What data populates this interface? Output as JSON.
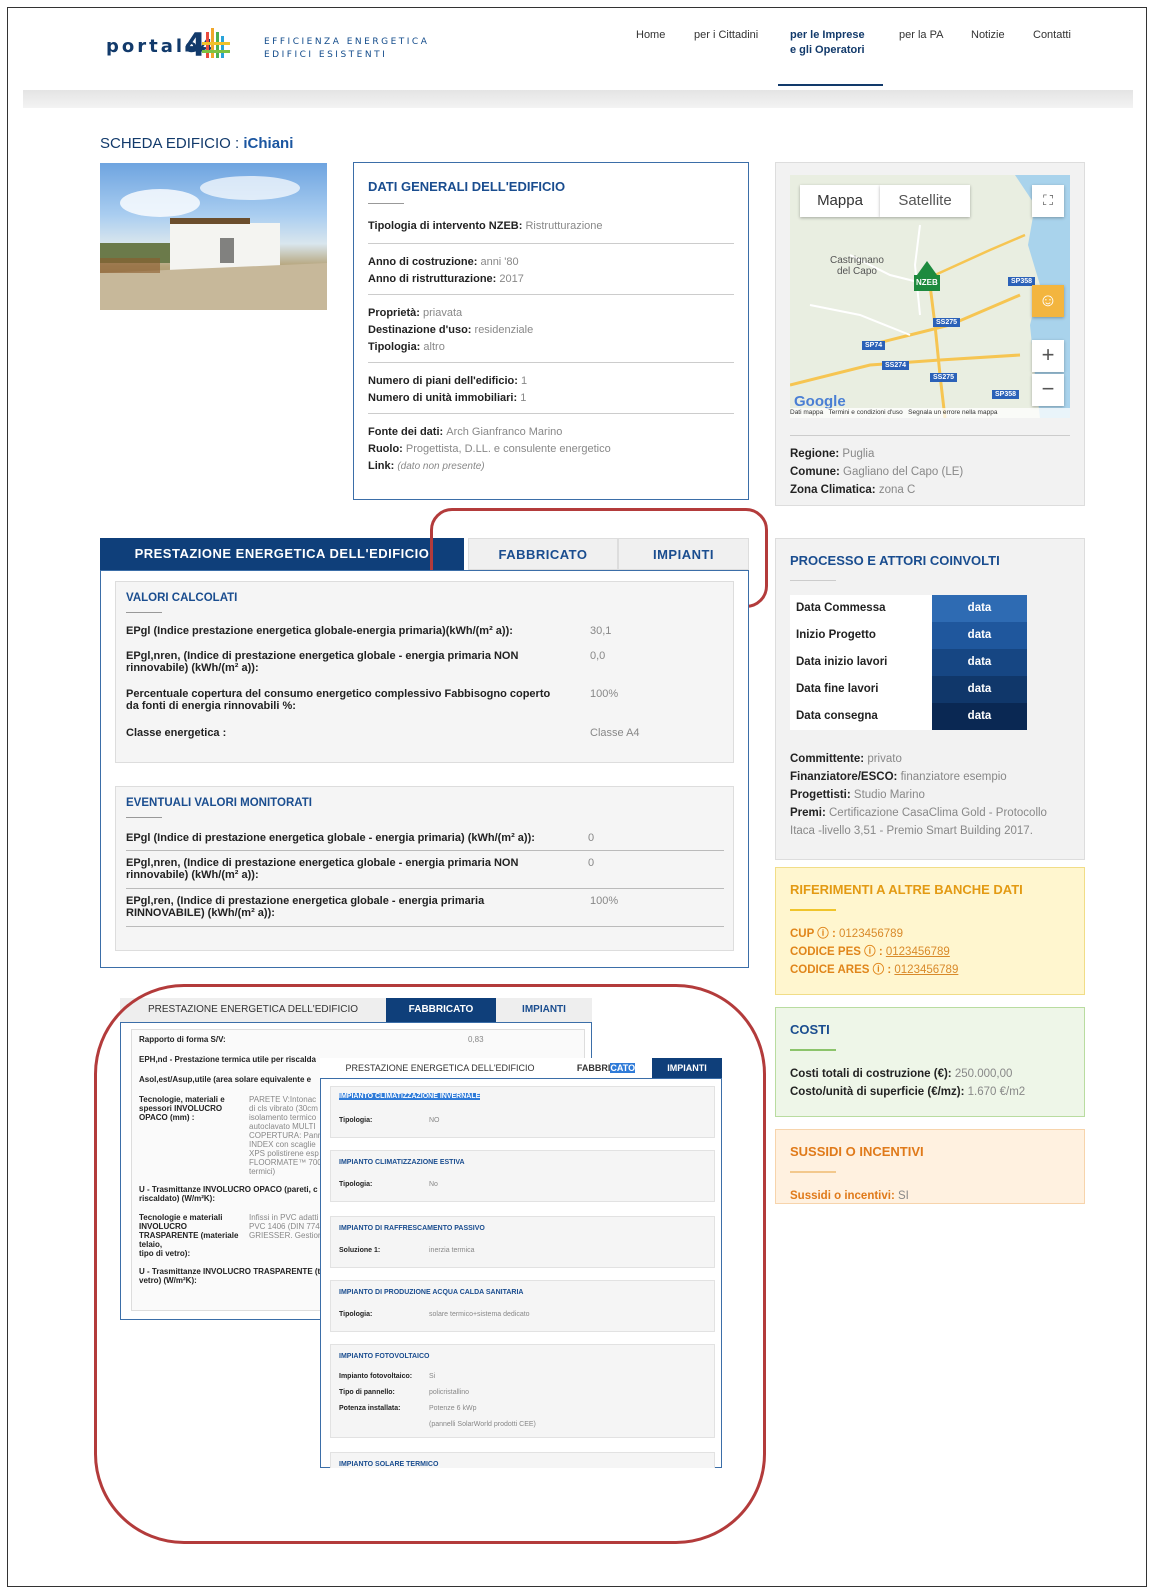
{
  "header": {
    "logo_text": "portale4",
    "tagline_1": "EFFICIENZA ENERGETICA",
    "tagline_2": "EDIFICI ESISTENTI",
    "nav": [
      "Home",
      "per i Cittadini",
      "per le Imprese",
      "e gli Operatori",
      "per la PA",
      "Notizie",
      "Contatti"
    ]
  },
  "page_title": {
    "label": "SCHEDA EDIFICIO :",
    "name": "iChiani"
  },
  "general": {
    "title": "DATI GENERALI DELL'EDIFICIO",
    "rows": [
      {
        "k": "Tipologia di intervento NZEB:",
        "v": "Ristrutturazione"
      },
      {
        "k": "Anno di costruzione:",
        "v": "anni '80"
      },
      {
        "k": "Anno di ristrutturazione:",
        "v": "2017"
      },
      {
        "k": "Proprietà:",
        "v": "priavata"
      },
      {
        "k": "Destinazione d'uso:",
        "v": "residenziale"
      },
      {
        "k": "Tipologia:",
        "v": "altro"
      },
      {
        "k": "Numero di piani dell'edificio:",
        "v": "1"
      },
      {
        "k": "Numero di unità immobiliari:",
        "v": "1"
      },
      {
        "k": "Fonte dei dati:",
        "v": "Arch Gianfranco Marino"
      },
      {
        "k": "Ruolo:",
        "v": "Progettista, D.LL. e consulente energetico"
      },
      {
        "k": "Link:",
        "v": "(dato non presente)"
      }
    ]
  },
  "map": {
    "type_map": "Mappa",
    "type_sat": "Satellite",
    "places": [
      "Castrignano",
      "del Capo",
      "NZEB"
    ],
    "roads": [
      "SP358",
      "SS275",
      "SP74",
      "SS274",
      "SS275",
      "SP358"
    ],
    "zoom_in": "+",
    "zoom_out": "−",
    "attrib": "Dati mappa   Termini e condizioni d'uso   Segnala un errore nella mappa",
    "google": "Google"
  },
  "location": [
    {
      "k": "Regione:",
      "v": "Puglia"
    },
    {
      "k": "Comune:",
      "v": "Gagliano del Capo (LE)"
    },
    {
      "k": "Zona Climatica:",
      "v": "zona C"
    }
  ],
  "tabs": [
    "PRESTAZIONE ENERGETICA DELL'EDIFICIO",
    "FABBRICATO",
    "IMPIANTI"
  ],
  "calc": {
    "title": "VALORI CALCOLATI",
    "rows": [
      {
        "k": "EPgl (Indice prestazione energetica globale-energia primaria)(kWh/(m² a)):",
        "v": "30,1"
      },
      {
        "k": "EPgl,nren, (Indice di prestazione energetica globale - energia primaria NON",
        "k2": "rinnovabile) (kWh/(m² a)):",
        "v": "0,0"
      },
      {
        "k": "Percentuale copertura del consumo energetico complessivo Fabbisogno coperto",
        "k2": "da fonti di energia rinnovabili %:",
        "v": "100%"
      },
      {
        "k": "Classe energetica :",
        "v": "Classe A4"
      }
    ]
  },
  "monit": {
    "title": "EVENTUALI VALORI MONITORATI",
    "rows": [
      {
        "k": "EPgl (Indice di prestazione energetica globale - energia primaria) (kWh/(m² a)):",
        "v": "0"
      },
      {
        "k": "EPgl,nren, (Indice di prestazione energetica globale - energia primaria NON",
        "k2": "rinnovabile) (kWh/(m² a)):",
        "v": "0"
      },
      {
        "k": "EPgl,ren, (Indice di prestazione energetica globale - energia primaria",
        "k2": "RINNOVABILE) (kWh/(m² a)):",
        "v": "100%"
      }
    ]
  },
  "process": {
    "title": "PROCESSO E ATTORI COINVOLTI",
    "steps": [
      {
        "k": "Data Commessa",
        "v": "data"
      },
      {
        "k": "Inizio Progetto",
        "v": "data"
      },
      {
        "k": "Data inizio lavori",
        "v": "data"
      },
      {
        "k": "Data fine lavori",
        "v": "data"
      },
      {
        "k": "Data consegna",
        "v": "data"
      }
    ],
    "info": [
      {
        "k": "Committente:",
        "v": "privato"
      },
      {
        "k": "Finanziatore/ESCO:",
        "v": "finanziatore esempio"
      },
      {
        "k": "Progettisti:",
        "v": "Studio Marino"
      },
      {
        "k": "Premi:",
        "v": "Certificazione CasaClima Gold - Protocollo"
      },
      {
        "k": "",
        "v": "Itaca -livello 3,51 - Premio Smart Building 2017."
      }
    ]
  },
  "refs": {
    "title": "RIFERIMENTI A ALTRE BANCHE DATI",
    "rows": [
      {
        "k": "CUP",
        "v": "0123456789"
      },
      {
        "k": "CODICE PES",
        "v": "0123456789"
      },
      {
        "k": "CODICE ARES",
        "v": "0123456789"
      }
    ]
  },
  "costs": {
    "title": "COSTI",
    "rows": [
      {
        "k": "Costi totali di costruzione (€):",
        "v": "250.000,00"
      },
      {
        "k": "Costo/unità di superficie (€/mz):",
        "v": "1.670 €/m2"
      }
    ]
  },
  "subsidies": {
    "title": "SUSSIDI O INCENTIVI",
    "k": "Sussidi o incentivi:",
    "v": "SI"
  },
  "shot1": {
    "tabs": [
      "PRESTAZIONE ENERGETICA DELL'EDIFICIO",
      "FABBRICATO",
      "IMPIANTI"
    ],
    "r1": "Rapporto di forma S/V:",
    "r1v": "0,83",
    "r2": "EPH,nd - Prestazione termica utile per riscalda",
    "r3": "Asol,est/Asup,utile (area solare equivalente e",
    "r4a": "Tecnologie, materiali e",
    "r4b": "spessori INVOLUCRO",
    "r4c": "OPACO (mm) :",
    "r4v": [
      "PARETE V:Intonac",
      "di cls vibrato (30cm",
      "isolamento termico",
      "autoclavato MULTI",
      "COPERTURA: Pann",
      "INDEX con scaglie",
      "XPS polistirene esp",
      "FLOORMATE™ 700",
      "termici)"
    ],
    "r5a": "U - Trasmittanze INVOLUCRO OPACO (pareti, c",
    "r5b": "riscaldato) (W/m²K):",
    "r6a": "Tecnologie e materiali",
    "r6b": "INVOLUCRO",
    "r6c": "TRASPARENTE (materiale",
    "r6d": "telaio,",
    "r6e": "tipo di vetro):",
    "r6v": [
      "Infissi in PVC adatti",
      "PVC 1406 (DIN 774)",
      "GRIESSER. Gestion"
    ],
    "r7a": "U - Trasmittanze INVOLUCRO TRASPARENTE (t",
    "r7b": "vetro) (W/m²K):"
  },
  "shot2": {
    "tabs": [
      "PRESTAZIONE ENERGETICA DELL'EDIFICIO",
      "FABBRI",
      "CATO",
      "IMPIANTI"
    ],
    "sections": [
      {
        "h": "IMPIANTO CLIMATIZZAZIONE INVERNALE",
        "rows": [
          {
            "k": "Tipologia:",
            "v": "NO"
          }
        ]
      },
      {
        "h": "IMPIANTO CLIMATIZZAZIONE ESTIVA",
        "rows": [
          {
            "k": "Tipologia:",
            "v": "No"
          }
        ]
      },
      {
        "h": "IMPIANTO DI RAFFRESCAMENTO PASSIVO",
        "rows": [
          {
            "k": "Soluzione 1:",
            "v": "inerzia termica"
          }
        ]
      },
      {
        "h": "IMPIANTO DI PRODUZIONE ACQUA CALDA SANITARIA",
        "rows": [
          {
            "k": "Tipologia:",
            "v": "solare termico+sistema dedicato"
          }
        ]
      },
      {
        "h": "IMPIANTO FOTOVOLTAICO",
        "rows": [
          {
            "k": "Impianto fotovoltaico:",
            "v": "Si"
          },
          {
            "k": "Tipo di pannello:",
            "v": "policristallino"
          },
          {
            "k": "Potenza installata:",
            "v": "Potenze 6 kWp"
          },
          {
            "k": "",
            "v": "(pannelli SolarWorld prodotti CEE)"
          }
        ]
      },
      {
        "h": "IMPIANTO SOLARE TERMICO",
        "rows": []
      }
    ]
  },
  "colors": {
    "navy": "#0f3f7a",
    "accent_red": "#b33b3b",
    "yellow_bg": "#fff6cf",
    "green_bg": "#eef6e8",
    "orange_bg": "#fff1e0"
  }
}
